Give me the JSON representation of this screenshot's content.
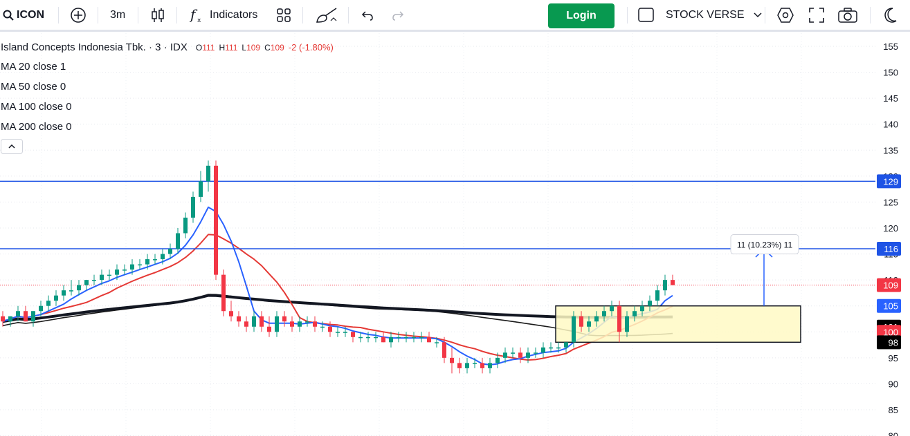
{
  "toolbar": {
    "symbol": "ICON",
    "interval": "3m",
    "indicators_label": "Indicators",
    "login_label": "Login",
    "layout_name": "STOCK VERSE"
  },
  "legend": {
    "title": "Island Concepts Indonesia Tbk. · 3 · IDX",
    "o_key": "O",
    "o_val": "111",
    "h_key": "H",
    "h_val": "111",
    "l_key": "L",
    "l_val": "109",
    "c_key": "C",
    "c_val": "109",
    "change": "-2 (-1.80%)",
    "ma20": "MA 20 close 1",
    "ma50": "MA 50 close 0",
    "ma100": "MA 100 close 0",
    "ma200": "MA 200 close 0"
  },
  "colors": {
    "up": "#089981",
    "down": "#f23645",
    "ma20": "#2962ff",
    "ma50": "#e53935",
    "ma100": "#1a1a1a",
    "ma200": "#131722",
    "hline": "#1e53e5",
    "box_fill": "#fff9c4",
    "login": "#089950"
  },
  "chart_data": {
    "type": "candlestick",
    "y_axis_ticks": [
      155,
      150,
      145,
      140,
      135,
      130,
      125,
      120,
      115,
      110,
      105,
      100,
      95,
      90,
      85,
      80
    ],
    "ylim": [
      80,
      157
    ],
    "horizontal_lines": [
      129,
      116
    ],
    "price_labels": [
      {
        "value": "129",
        "price": 129,
        "kind": "hline"
      },
      {
        "value": "116",
        "price": 116,
        "kind": "hline"
      },
      {
        "value": "109",
        "price": 109,
        "kind": "last"
      },
      {
        "value": "105",
        "price": 105,
        "kind": "ma20"
      },
      {
        "value": "101",
        "price": 101,
        "kind": "ma200"
      },
      {
        "value": "100",
        "price": 100,
        "kind": "ma50"
      },
      {
        "value": "98",
        "price": 98,
        "kind": "ma100"
      }
    ],
    "last_price": 109,
    "measure_label": "11 (10.23%) 11",
    "measure_box": {
      "price_low": 98.0,
      "price_high": 105.0
    },
    "measure_arrow_top": 116,
    "candles": [
      [
        103,
        104,
        101,
        102
      ],
      [
        102,
        103,
        101,
        103
      ],
      [
        103,
        105,
        102,
        104
      ],
      [
        104,
        105,
        102,
        102
      ],
      [
        102,
        104,
        101,
        104
      ],
      [
        104,
        106,
        103,
        105
      ],
      [
        105,
        107,
        104,
        106
      ],
      [
        106,
        108,
        105,
        107
      ],
      [
        107,
        109,
        106,
        108
      ],
      [
        108,
        110,
        107,
        108
      ],
      [
        108,
        110,
        107,
        109
      ],
      [
        109,
        110,
        108,
        110
      ],
      [
        110,
        111,
        109,
        110
      ],
      [
        110,
        112,
        109,
        111
      ],
      [
        111,
        112,
        110,
        111
      ],
      [
        111,
        113,
        110,
        112
      ],
      [
        112,
        113,
        111,
        112
      ],
      [
        112,
        114,
        111,
        113
      ],
      [
        113,
        114,
        112,
        113
      ],
      [
        113,
        115,
        112,
        114
      ],
      [
        114,
        115,
        113,
        114
      ],
      [
        114,
        116,
        113,
        115
      ],
      [
        115,
        117,
        114,
        116
      ],
      [
        116,
        120,
        115,
        119
      ],
      [
        119,
        123,
        118,
        122
      ],
      [
        122,
        127,
        121,
        126
      ],
      [
        126,
        131,
        125,
        129
      ],
      [
        129,
        133,
        127,
        132
      ],
      [
        132,
        133,
        110,
        111
      ],
      [
        111,
        112,
        103,
        104
      ],
      [
        104,
        106,
        102,
        103
      ],
      [
        103,
        104,
        101,
        102
      ],
      [
        102,
        103,
        100,
        101
      ],
      [
        101,
        104,
        100,
        103
      ],
      [
        103,
        104,
        100,
        101
      ],
      [
        101,
        103,
        99,
        100
      ],
      [
        100,
        104,
        99,
        103
      ],
      [
        103,
        104,
        101,
        102
      ],
      [
        102,
        103,
        100,
        101
      ],
      [
        101,
        103,
        100,
        102
      ],
      [
        102,
        103,
        101,
        102
      ],
      [
        102,
        103,
        100,
        101
      ],
      [
        101,
        102,
        100,
        101
      ],
      [
        101,
        102,
        99,
        100
      ],
      [
        100,
        101,
        99,
        100
      ],
      [
        100,
        101,
        99,
        100
      ],
      [
        100,
        100,
        98,
        99
      ],
      [
        99,
        100,
        98,
        99
      ],
      [
        99,
        100,
        98,
        99
      ],
      [
        99,
        100,
        98,
        99
      ],
      [
        99,
        100,
        98,
        98
      ],
      [
        98,
        100,
        97,
        99
      ],
      [
        99,
        100,
        98,
        99
      ],
      [
        99,
        100,
        98,
        99
      ],
      [
        99,
        100,
        98,
        99
      ],
      [
        99,
        100,
        98,
        99
      ],
      [
        99,
        100,
        98,
        98
      ],
      [
        98,
        99,
        97,
        98
      ],
      [
        98,
        99,
        94,
        95
      ],
      [
        95,
        97,
        92,
        94
      ],
      [
        94,
        95,
        92,
        93
      ],
      [
        93,
        95,
        92,
        94
      ],
      [
        94,
        95,
        93,
        94
      ],
      [
        94,
        95,
        92,
        93
      ],
      [
        93,
        95,
        92,
        94
      ],
      [
        94,
        96,
        93,
        95
      ],
      [
        95,
        97,
        94,
        96
      ],
      [
        96,
        97,
        95,
        96
      ],
      [
        96,
        97,
        94,
        95
      ],
      [
        95,
        97,
        94,
        96
      ],
      [
        96,
        97,
        95,
        96
      ],
      [
        96,
        98,
        95,
        97
      ],
      [
        97,
        98,
        96,
        97
      ],
      [
        97,
        98,
        96,
        97
      ],
      [
        97,
        98,
        96,
        98
      ],
      [
        98,
        104,
        97,
        103
      ],
      [
        103,
        104,
        100,
        101
      ],
      [
        101,
        103,
        100,
        102
      ],
      [
        102,
        104,
        101,
        103
      ],
      [
        103,
        105,
        102,
        104
      ],
      [
        104,
        106,
        103,
        105
      ],
      [
        105,
        106,
        98,
        100
      ],
      [
        100,
        104,
        99,
        103
      ],
      [
        103,
        105,
        102,
        104
      ],
      [
        104,
        106,
        103,
        105
      ],
      [
        105,
        107,
        104,
        106
      ],
      [
        106,
        109,
        105,
        108
      ],
      [
        108,
        111,
        107,
        110
      ],
      [
        110,
        111,
        109,
        109
      ]
    ]
  }
}
